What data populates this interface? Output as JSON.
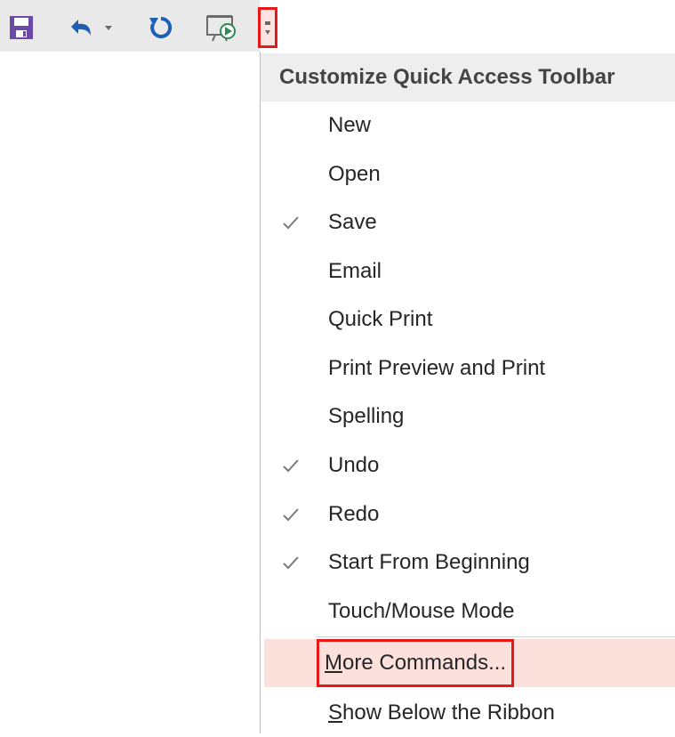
{
  "toolbar": {
    "buttons": [
      {
        "name": "save",
        "icon": "save-icon"
      },
      {
        "name": "undo",
        "icon": "undo-icon"
      },
      {
        "name": "undo-dropdown",
        "icon": "chevron-down-icon"
      },
      {
        "name": "redo",
        "icon": "redo-icon"
      },
      {
        "name": "start-from-beginning",
        "icon": "presentation-play-icon"
      },
      {
        "name": "customize",
        "icon": "customize-dropdown-icon"
      }
    ],
    "accent_color": "#6b4aa8",
    "highlight_color": "#e81818"
  },
  "menu": {
    "header": "Customize Quick Access Toolbar",
    "items": [
      {
        "label": "New",
        "checked": false
      },
      {
        "label": "Open",
        "checked": false
      },
      {
        "label": "Save",
        "checked": true
      },
      {
        "label": "Email",
        "checked": false
      },
      {
        "label": "Quick Print",
        "checked": false
      },
      {
        "label": "Print Preview and Print",
        "checked": false
      },
      {
        "label": "Spelling",
        "checked": false
      },
      {
        "label": "Undo",
        "checked": true
      },
      {
        "label": "Redo",
        "checked": true
      },
      {
        "label": "Start From Beginning",
        "checked": true
      },
      {
        "label": "Touch/Mouse Mode",
        "checked": false
      }
    ],
    "more_commands": {
      "mnemonic": "M",
      "rest": "ore Commands..."
    },
    "show_below": {
      "mnemonic": "S",
      "rest": "how Below the Ribbon"
    }
  }
}
